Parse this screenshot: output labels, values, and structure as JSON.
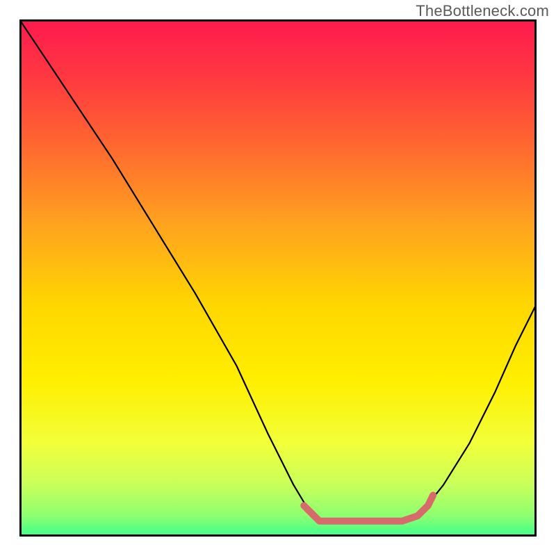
{
  "watermark": "TheBottleneck.com",
  "chart_data": {
    "type": "line",
    "title": "",
    "xlabel": "",
    "ylabel": "",
    "xlim": [
      0,
      100
    ],
    "ylim": [
      0,
      100
    ],
    "background": {
      "stops": [
        {
          "offset": 0.0,
          "color": "#ff194f"
        },
        {
          "offset": 0.12,
          "color": "#ff3b3f"
        },
        {
          "offset": 0.25,
          "color": "#ff6a2f"
        },
        {
          "offset": 0.4,
          "color": "#ffa41f"
        },
        {
          "offset": 0.55,
          "color": "#ffd600"
        },
        {
          "offset": 0.7,
          "color": "#ffef00"
        },
        {
          "offset": 0.82,
          "color": "#f2ff3a"
        },
        {
          "offset": 0.9,
          "color": "#c8ff5a"
        },
        {
          "offset": 0.96,
          "color": "#8cff70"
        },
        {
          "offset": 1.0,
          "color": "#3cff8c"
        }
      ]
    },
    "series": [
      {
        "name": "bottleneck-curve",
        "color": "#000000",
        "width": 2.2,
        "points": [
          {
            "x": 0,
            "y": 100
          },
          {
            "x": 4,
            "y": 94
          },
          {
            "x": 10,
            "y": 85
          },
          {
            "x": 18,
            "y": 73
          },
          {
            "x": 26,
            "y": 60
          },
          {
            "x": 34,
            "y": 47
          },
          {
            "x": 42,
            "y": 33
          },
          {
            "x": 48,
            "y": 20
          },
          {
            "x": 53,
            "y": 10
          },
          {
            "x": 56,
            "y": 5
          },
          {
            "x": 58,
            "y": 3
          },
          {
            "x": 62,
            "y": 3
          },
          {
            "x": 68,
            "y": 3
          },
          {
            "x": 74,
            "y": 3
          },
          {
            "x": 78,
            "y": 5
          },
          {
            "x": 82,
            "y": 10
          },
          {
            "x": 87,
            "y": 18
          },
          {
            "x": 92,
            "y": 28
          },
          {
            "x": 96,
            "y": 37
          },
          {
            "x": 100,
            "y": 45
          }
        ]
      },
      {
        "name": "bottleneck-highlight",
        "color": "#d76a6a",
        "width": 10,
        "points": [
          {
            "x": 55,
            "y": 6
          },
          {
            "x": 56,
            "y": 5
          },
          {
            "x": 58,
            "y": 3
          },
          {
            "x": 62,
            "y": 3
          },
          {
            "x": 68,
            "y": 3
          },
          {
            "x": 74,
            "y": 3
          },
          {
            "x": 77,
            "y": 4
          },
          {
            "x": 79,
            "y": 6
          },
          {
            "x": 80,
            "y": 8
          }
        ]
      }
    ]
  }
}
